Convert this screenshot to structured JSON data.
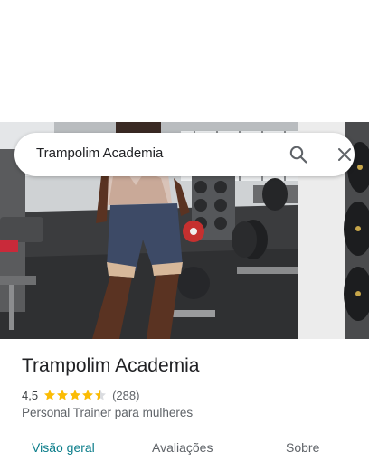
{
  "search": {
    "query": "Trampolim Academia"
  },
  "place": {
    "name": "Trampolim Academia",
    "rating": "4,5",
    "stars_filled": 4.5,
    "review_count": "(288)",
    "category": "Personal Trainer para mulheres"
  },
  "tabs": [
    {
      "label": "Visão geral",
      "active": true
    },
    {
      "label": "Avaliações",
      "active": false
    },
    {
      "label": "Sobre",
      "active": false
    }
  ],
  "colors": {
    "accent": "#0b7d8a",
    "star": "#fbbc04",
    "text_primary": "#202124",
    "text_secondary": "#5f6368"
  },
  "icons": [
    "search-icon",
    "close-icon",
    "star-icon",
    "half-star-icon"
  ]
}
